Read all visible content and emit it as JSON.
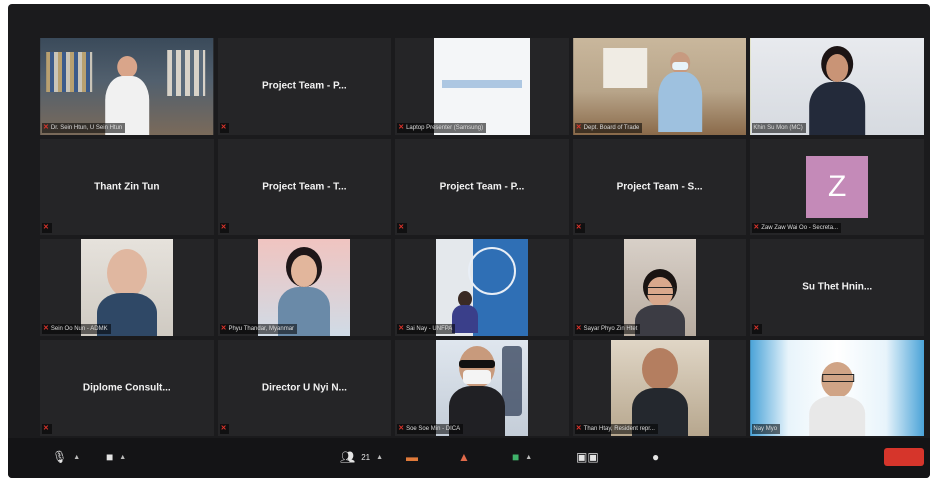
{
  "tiles": [
    {
      "name": "",
      "label": "Dr. Sein Htun, U Sein Htun",
      "muted": true
    },
    {
      "name": "Project Team - P...",
      "label": "",
      "muted": true
    },
    {
      "name": "",
      "label": "Laptop Presenter (Samsung)",
      "muted": true
    },
    {
      "name": "",
      "label": "Dept. Board of Trade",
      "muted": true
    },
    {
      "name": "",
      "label": "Khin Su Mon (MC)",
      "muted": false
    },
    {
      "name": "Thant Zin Tun",
      "label": "",
      "muted": true
    },
    {
      "name": "Project Team - T...",
      "label": "",
      "muted": true
    },
    {
      "name": "Project Team - P...",
      "label": "",
      "muted": true
    },
    {
      "name": "Project Team - S...",
      "label": "",
      "muted": true
    },
    {
      "name": "",
      "label": "Zaw Zaw Wai Oo - Secreta...",
      "muted": true,
      "avatar": "Z"
    },
    {
      "name": "",
      "label": "Sein Oo Nun - ADMK",
      "muted": true
    },
    {
      "name": "",
      "label": "Phyu Thandar, Myanmar",
      "muted": true
    },
    {
      "name": "",
      "label": "Sai Nay - UNFPA",
      "muted": true
    },
    {
      "name": "",
      "label": "Sayar Phyo Zin Htet",
      "muted": true
    },
    {
      "name": "Su Thet Hnin...",
      "label": "",
      "muted": true
    },
    {
      "name": "Diplome Consult...",
      "label": "",
      "muted": true
    },
    {
      "name": "Director U Nyi N...",
      "label": "",
      "muted": true
    },
    {
      "name": "",
      "label": "Soe Soe Min - DICA",
      "muted": true
    },
    {
      "name": "",
      "label": "Than Htay, Resident repr...",
      "muted": true
    },
    {
      "name": "",
      "label": "Nay Myo",
      "muted": false
    }
  ],
  "toolbar": {
    "mute_icon": "microphone-muted-icon",
    "video_icon": "video-camera-icon",
    "participants_count": "21",
    "share_icon": "share-screen-icon",
    "chat_icon": "chat-icon",
    "record_icon": "record-icon",
    "reactions_icon": "reactions-icon",
    "more_icon": "more-icon"
  },
  "colors": {
    "active_speaker": "#d6cf3a",
    "muted": "#e0342b",
    "avatar_bg": "#c48ab8"
  }
}
